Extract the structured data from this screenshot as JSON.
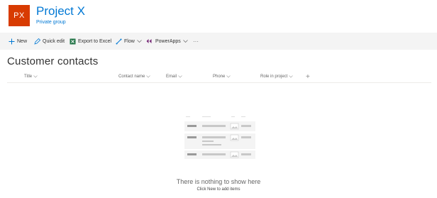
{
  "site": {
    "logo_initials": "PX",
    "title": "Project X",
    "subtitle": "Private group",
    "logo_color": "#d83b01",
    "accent_color": "#0078d4"
  },
  "command_bar": {
    "items": [
      {
        "label": "New",
        "icon": "plus-icon"
      },
      {
        "label": "Quick edit",
        "icon": "pencil-icon"
      },
      {
        "label": "Export to Excel",
        "icon": "excel-icon"
      },
      {
        "label": "Flow",
        "icon": "flow-icon",
        "has_dropdown": true
      },
      {
        "label": "PowerApps",
        "icon": "powerapps-icon",
        "has_dropdown": true
      },
      {
        "label": "···",
        "icon": "more-icon"
      }
    ]
  },
  "list": {
    "title": "Customer contacts",
    "columns": [
      "Title",
      "Contact name",
      "Email",
      "Phone",
      "Role in project"
    ],
    "add_column_symbol": "+"
  },
  "empty_state": {
    "title": "There is nothing to show here",
    "subtitle": "Click New to add items"
  }
}
